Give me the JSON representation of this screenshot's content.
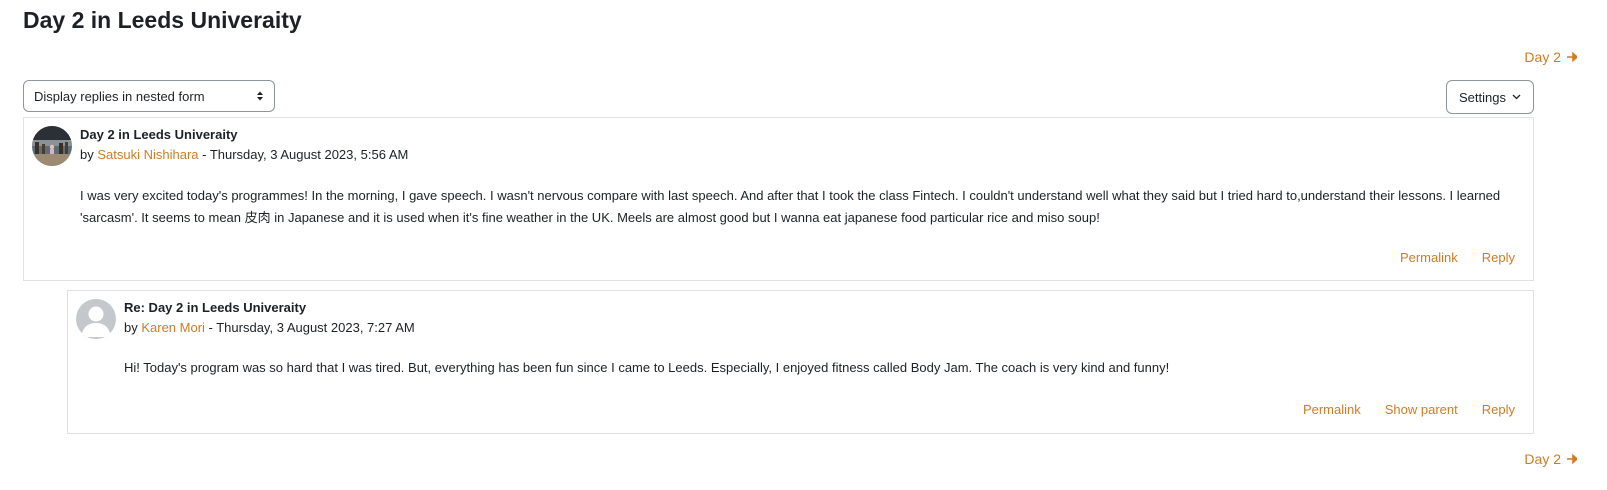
{
  "discussion": {
    "title": "Day 2 in Leeds Univeraity",
    "next_discussion_top": "Day 2",
    "next_discussion_bottom": "Day 2"
  },
  "controls": {
    "display_mode_value": "Display replies in nested form",
    "settings_label": "Settings"
  },
  "posts": [
    {
      "subject": "Day 2 in Leeds Univeraity",
      "by_prefix": "by",
      "author": "Satsuki Nishihara",
      "date_text": " - Thursday, 3 August 2023, 5:56 AM",
      "body": "I was very excited today's programmes! In the morning, I gave speech. I wasn't nervous compare with last speech. And after that I took the class Fintech. I couldn't understand well what they said but I tried hard to,understand their lessons. I learned 'sarcasm'. It seems to mean 皮肉 in Japanese and it is used when it's fine weather in the UK. Meels are almost good but I wanna eat japanese food particular rice and miso soup!",
      "actions": {
        "permalink": "Permalink",
        "reply": "Reply"
      }
    },
    {
      "subject": "Re: Day 2 in Leeds Univeraity",
      "by_prefix": "by",
      "author": "Karen Mori",
      "date_text": " - Thursday, 3 August 2023, 7:27 AM",
      "body": "Hi! Today's program was so hard that I was tired. But, everything has been fun since I came to Leeds. Especially, I enjoyed fitness called Body Jam. The coach is very kind and funny!",
      "actions": {
        "permalink": "Permalink",
        "show_parent": "Show parent",
        "reply": "Reply"
      }
    }
  ],
  "colors": {
    "link": "#d07c25",
    "text": "#1d2125",
    "border": "#dee2e6"
  }
}
